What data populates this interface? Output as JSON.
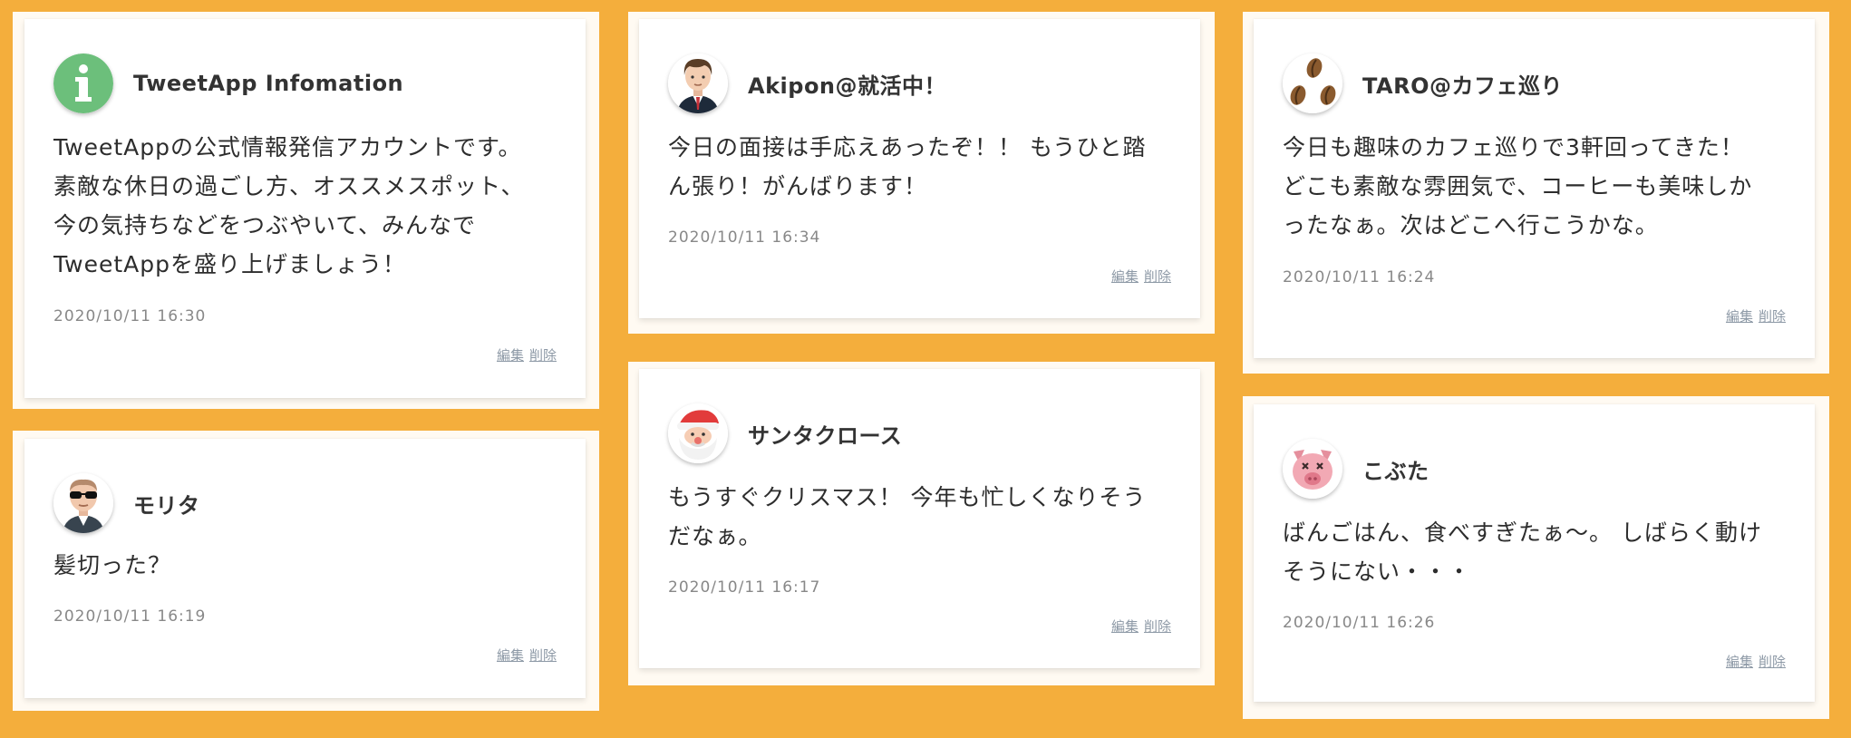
{
  "posts": [
    {
      "user": "TweetApp Infomation",
      "avatar": "info-icon",
      "content": "TweetAppの公式情報発信アカウントです。\n素敵な休日の過ごし方、オススメスポット、\n今の気持ちなどをつぶやいて、みんなで\nTweetAppを盛り上げましょう！",
      "timestamp": "2020/10/11 16:30",
      "edit_label": "編集",
      "delete_label": "削除"
    },
    {
      "user": "モリタ",
      "avatar": "sunglasses-man-avatar",
      "content": "髪切った？",
      "timestamp": "2020/10/11 16:19",
      "edit_label": "編集",
      "delete_label": "削除"
    },
    {
      "user": "Akipon@就活中！",
      "avatar": "business-man-avatar",
      "content": "今日の面接は手応えあったぞ！！ もうひと踏\nん張り！がんばります！",
      "timestamp": "2020/10/11 16:34",
      "edit_label": "編集",
      "delete_label": "削除"
    },
    {
      "user": "サンタクロース",
      "avatar": "santa-avatar",
      "content": "もうすぐクリスマス！ 今年も忙しくなりそう\nだなぁ。",
      "timestamp": "2020/10/11 16:17",
      "edit_label": "編集",
      "delete_label": "削除"
    },
    {
      "user": "TARO@カフェ巡り",
      "avatar": "coffee-beans-avatar",
      "content": "今日も趣味のカフェ巡りで3軒回ってきた！\nどこも素敵な雰囲気で、コーヒーも美味しか\nったなぁ。次はどこへ行こうかな。",
      "timestamp": "2020/10/11 16:24",
      "edit_label": "編集",
      "delete_label": "削除"
    },
    {
      "user": "こぶた",
      "avatar": "pig-avatar",
      "content": "ばんごはん、食べすぎたぁ〜。 しばらく動け\nそうにない・・・",
      "timestamp": "2020/10/11 16:26",
      "edit_label": "編集",
      "delete_label": "削除"
    }
  ],
  "colors": {
    "background": "#f4ae3c",
    "card": "#ffffff",
    "timestamp": "#888888",
    "action_link": "#8d99a6"
  }
}
